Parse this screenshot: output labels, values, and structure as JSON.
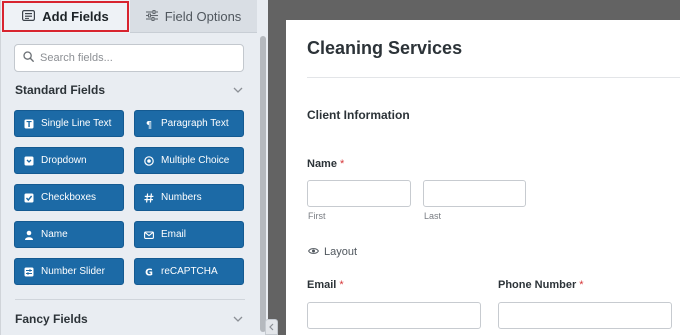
{
  "panel": {
    "tabs": [
      {
        "label": "Add Fields",
        "icon": "fields-list-icon",
        "active": true
      },
      {
        "label": "Field Options",
        "icon": "sliders-icon",
        "active": false
      }
    ],
    "search": {
      "placeholder": "Search fields...",
      "value": ""
    },
    "sections": {
      "standard": {
        "title": "Standard Fields",
        "expanded": true
      },
      "fancy": {
        "title": "Fancy Fields",
        "expanded": true
      }
    },
    "standard_fields": [
      {
        "label": "Single Line Text",
        "icon": "single-line-text-icon"
      },
      {
        "label": "Paragraph Text",
        "icon": "paragraph-icon"
      },
      {
        "label": "Dropdown",
        "icon": "dropdown-icon"
      },
      {
        "label": "Multiple Choice",
        "icon": "radio-icon"
      },
      {
        "label": "Checkboxes",
        "icon": "checkbox-icon"
      },
      {
        "label": "Numbers",
        "icon": "hash-icon"
      },
      {
        "label": "Name",
        "icon": "user-icon"
      },
      {
        "label": "Email",
        "icon": "envelope-icon"
      },
      {
        "label": "Number Slider",
        "icon": "slider-icon"
      },
      {
        "label": "reCAPTCHA",
        "icon": "google-g-icon"
      }
    ],
    "colors": {
      "button": "#1c6aa6",
      "tab_highlight": "#d8242f"
    }
  },
  "form": {
    "title": "Cleaning Services",
    "section_title": "Client Information",
    "name_field": {
      "label": "Name",
      "required_marker": "*",
      "sublabels": {
        "first": "First",
        "last": "Last"
      }
    },
    "layout_label": "Layout",
    "email_field": {
      "label": "Email",
      "required_marker": "*"
    },
    "phone_field": {
      "label": "Phone Number",
      "required_marker": "*"
    },
    "colors": {
      "required": "#d63638"
    }
  }
}
